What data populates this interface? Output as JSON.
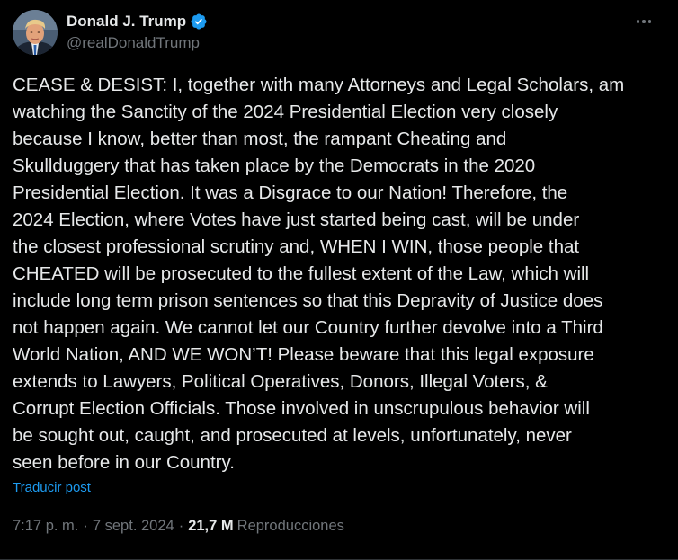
{
  "author": {
    "display_name": "Donald J. Trump",
    "handle": "@realDonaldTrump",
    "verified": true,
    "verified_color": "#1d9bf0"
  },
  "post": {
    "lines": [
      "CEASE & DESIST: I, together with many Attorneys and Legal Scholars, am",
      "watching the Sanctity of the 2024 Presidential Election very closely",
      "because I know, better than most, the rampant Cheating and",
      "Skullduggery that has taken place by the Democrats in the 2020",
      "Presidential Election. It was a Disgrace to our Nation! Therefore, the",
      "2024 Election, where Votes have just started being cast, will be under",
      "the closest professional scrutiny and, WHEN I WIN, those people that",
      "CHEATED will be prosecuted to the fullest extent of the Law, which will",
      "include long term prison sentences so that this Depravity of Justice does",
      "not happen again. We cannot let our Country further devolve into a Third",
      "World Nation, AND WE WON’T! Please beware that this legal exposure",
      "extends to Lawyers, Political Operatives, Donors, Illegal Voters, &",
      "Corrupt Election Officials. Those involved in unscrupulous behavior will",
      "be sought out, caught, and prosecuted at levels, unfortunately, never",
      "seen before in our Country."
    ],
    "translate_label": "Traducir post",
    "time": "7:17 p. m.",
    "separator": "·",
    "date": "7 sept. 2024",
    "views_count": "21,7 M",
    "views_label": "Reproducciones"
  },
  "colors": {
    "background": "#000000",
    "text": "#e7e9ea",
    "muted": "#71767b",
    "link": "#1d9bf0"
  },
  "icons": {
    "more": "more-horizontal-icon",
    "verified": "verified-badge-icon"
  }
}
